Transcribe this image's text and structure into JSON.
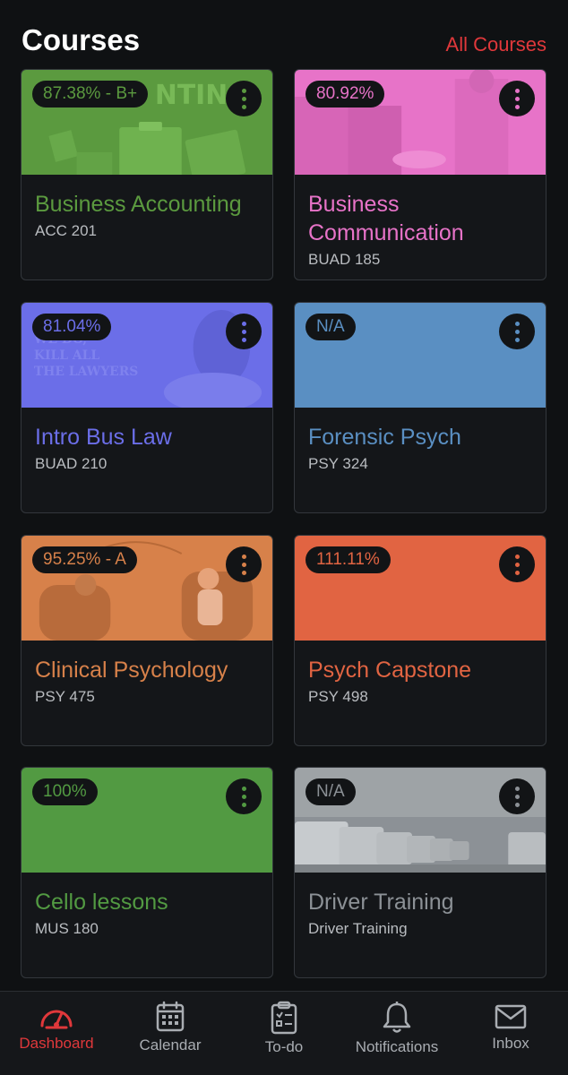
{
  "header": {
    "title": "Courses",
    "all_courses_label": "All Courses"
  },
  "colors": {
    "accent_red": "#e0383b",
    "tab_inactive": "#a9adb2"
  },
  "courses": [
    {
      "grade": "87.38% - B+",
      "name": "Business Accounting",
      "code": "ACC 201",
      "color": "#5b9a3f",
      "banner_image": "accounting-clipboard-illustration"
    },
    {
      "grade": "80.92%",
      "name": "Business Communication",
      "code": "BUAD 185",
      "color": "#e773c8",
      "banner_image": "business-handshake-photo"
    },
    {
      "grade": "81.04%",
      "name": "Intro Bus Law",
      "code": "BUAD 210",
      "color": "#6b6ee8",
      "banner_image": "shakespeare-quote-engraving"
    },
    {
      "grade": "N/A",
      "name": "Forensic Psych",
      "code": "PSY 324",
      "color": "#5a8fc2",
      "banner_image": ""
    },
    {
      "grade": "95.25% - A",
      "name": "Clinical Psychology",
      "code": "PSY 475",
      "color": "#d7814a",
      "banner_image": "therapy-session-illustration"
    },
    {
      "grade": "111.11%",
      "name": "Psych Capstone",
      "code": "PSY 498",
      "color": "#e16442",
      "banner_image": ""
    },
    {
      "grade": "100%",
      "name": "Cello lessons",
      "code": "MUS 180",
      "color": "#529a42",
      "banner_image": ""
    },
    {
      "grade": "N/A",
      "name": "Driver Training",
      "code": "Driver Training",
      "color": "#8c9196",
      "banner_image": "parked-vans-photo"
    }
  ],
  "tabs": [
    {
      "label": "Dashboard",
      "icon": "dashboard-gauge-icon",
      "active": true
    },
    {
      "label": "Calendar",
      "icon": "calendar-icon",
      "active": false
    },
    {
      "label": "To-do",
      "icon": "clipboard-checklist-icon",
      "active": false
    },
    {
      "label": "Notifications",
      "icon": "bell-icon",
      "active": false
    },
    {
      "label": "Inbox",
      "icon": "envelope-icon",
      "active": false
    }
  ]
}
